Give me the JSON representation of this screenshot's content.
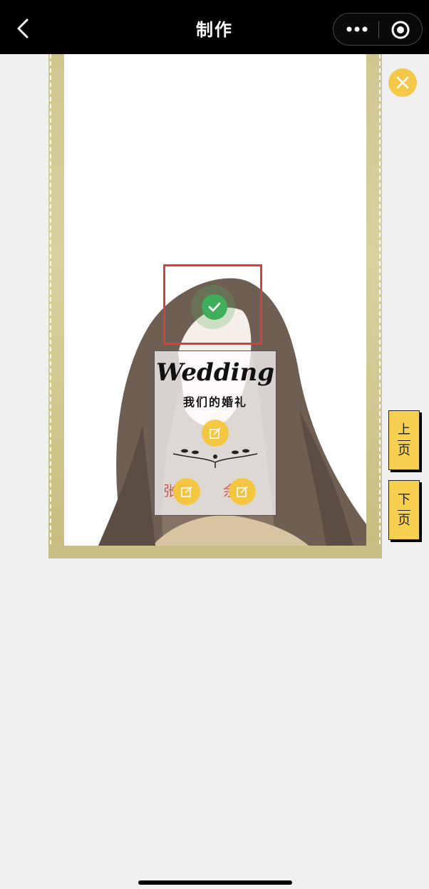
{
  "nav": {
    "title": "制作",
    "back_icon": "chevron-left-icon",
    "more_icon": "more-dots-icon",
    "target_icon": "record-target-icon"
  },
  "card": {
    "title": "Wedding",
    "subtitle": "我们的婚礼",
    "groom_name": "张明",
    "bride_name": "余娇",
    "frame_color": "#cfc690"
  },
  "actions": {
    "confirm_icon": "checkmark-icon",
    "close_icon": "close-icon",
    "prev_page_label_1": "上",
    "prev_page_label_2": "页",
    "next_page_label_1": "下",
    "next_page_label_2": "页"
  },
  "colors": {
    "accent_yellow": "#f7d04f",
    "confirm_green": "#3fae5a",
    "selection_red": "#e53935",
    "name_red": "#d05a46"
  }
}
